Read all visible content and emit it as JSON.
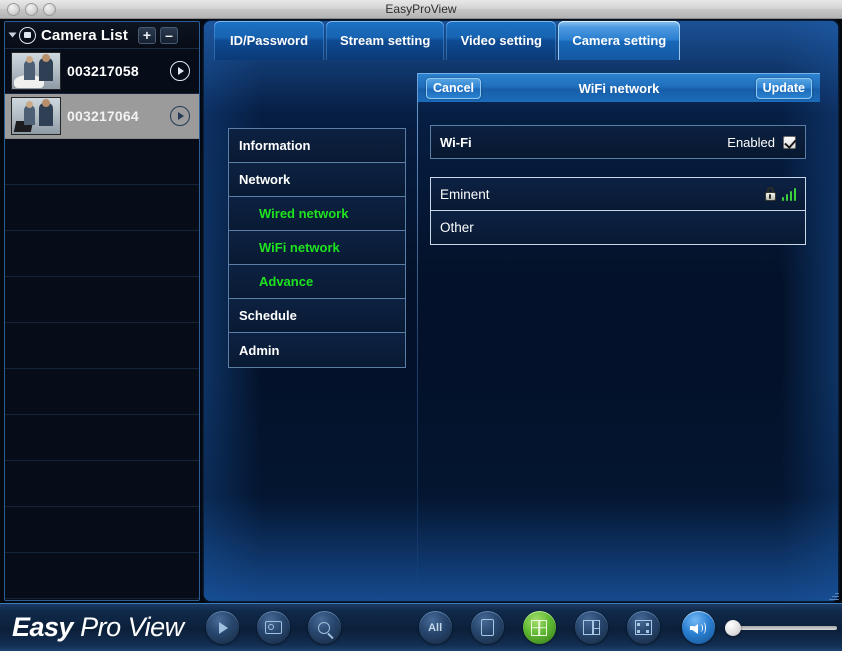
{
  "window": {
    "title": "EasyProView",
    "controls": [
      "close",
      "minimize",
      "zoom"
    ]
  },
  "sidebar": {
    "title": "Camera List",
    "add_label": "+",
    "remove_label": "–",
    "cameras": [
      {
        "name": "003217058",
        "selected": false
      },
      {
        "name": "003217064",
        "selected": true
      }
    ],
    "empty_row_count": 10
  },
  "tabs": [
    {
      "label": "ID/Password",
      "active": false
    },
    {
      "label": "Stream setting",
      "active": false
    },
    {
      "label": "Video setting",
      "active": false
    },
    {
      "label": "Camera setting",
      "active": true
    }
  ],
  "sheet": {
    "cancel_label": "Cancel",
    "title": "WiFi network",
    "update_label": "Update"
  },
  "menu": [
    {
      "label": "Information",
      "sub": false
    },
    {
      "label": "Network",
      "sub": false
    },
    {
      "label": "Wired network",
      "sub": true
    },
    {
      "label": "WiFi network",
      "sub": true
    },
    {
      "label": "Advance",
      "sub": true
    },
    {
      "label": "Schedule",
      "sub": false
    },
    {
      "label": "Admin",
      "sub": false
    }
  ],
  "wifi": {
    "toggle_label": "Wi-Fi",
    "toggle_value": "Enabled",
    "toggle_checked": true,
    "networks": [
      {
        "ssid": "Eminent",
        "secured": true,
        "signal": 4
      },
      {
        "ssid": "Other",
        "secured": false,
        "signal": 0
      }
    ]
  },
  "toolbar": {
    "logo_easy": "Easy",
    "logo_pro": "Pro",
    "logo_view": "View",
    "buttons_left": [
      {
        "name": "playback",
        "label": ""
      },
      {
        "name": "snapshot",
        "label": ""
      },
      {
        "name": "search",
        "label": ""
      }
    ],
    "buttons_mid": [
      {
        "name": "all-view",
        "label": "All"
      },
      {
        "name": "single-view",
        "label": ""
      },
      {
        "name": "quad-view",
        "label": ""
      },
      {
        "name": "six-view",
        "label": ""
      },
      {
        "name": "fullscreen-view",
        "label": ""
      }
    ],
    "volume_percent": 0
  },
  "colors": {
    "accent_blue": "#1d72c4",
    "active_tab_blue": "#2a7fd0",
    "submenu_green": "#1ee31e",
    "signal_green": "#3ad33a",
    "selected_row_gray": "#9b9b9b"
  }
}
